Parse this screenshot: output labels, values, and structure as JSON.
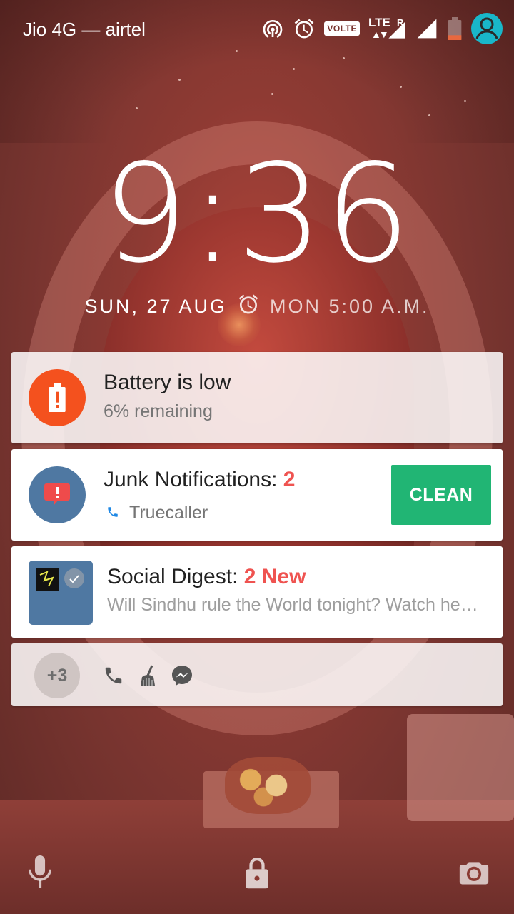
{
  "status_bar": {
    "carrier": "Jio 4G — airtel",
    "volte_label": "VOLTE",
    "lte_label": "LTE",
    "roaming_label": "R",
    "icons": [
      "hotspot-icon",
      "alarm-icon",
      "volte-badge",
      "lte-signal-icon",
      "signal-icon",
      "battery-low-icon",
      "user-avatar-icon"
    ],
    "battery_color": "#e8683f",
    "avatar_color": "#19b7c9"
  },
  "lockscreen": {
    "time": "9:36",
    "date": "SUN, 27 AUG",
    "next_alarm": "MON 5:00 A.M."
  },
  "notifications": [
    {
      "app_icon": "battery-alert-icon",
      "icon_color": "#f4511e",
      "title": "Battery is low",
      "subtitle": "6% remaining"
    },
    {
      "app_icon": "spam-alert-icon",
      "icon_color": "#4f78a2",
      "title_prefix": "Junk Notifications: ",
      "title_count": "2",
      "source_icon": "phone-icon",
      "source": "Truecaller",
      "action_label": "CLEAN",
      "action_color": "#21b574"
    },
    {
      "app_icon": "social-digest-icon",
      "icon_color": "#4f78a2",
      "title_prefix": "Social Digest: ",
      "title_highlight": "2 New",
      "subtitle": "Will Sindhu rule the World tonight? Watch he…"
    }
  ],
  "overflow": {
    "count_label": "+3",
    "icons": [
      "phone-icon",
      "cleaner-broom-icon",
      "messenger-icon"
    ]
  },
  "bottom_bar": {
    "icons": [
      "microphone-icon",
      "lock-icon",
      "camera-icon"
    ]
  }
}
